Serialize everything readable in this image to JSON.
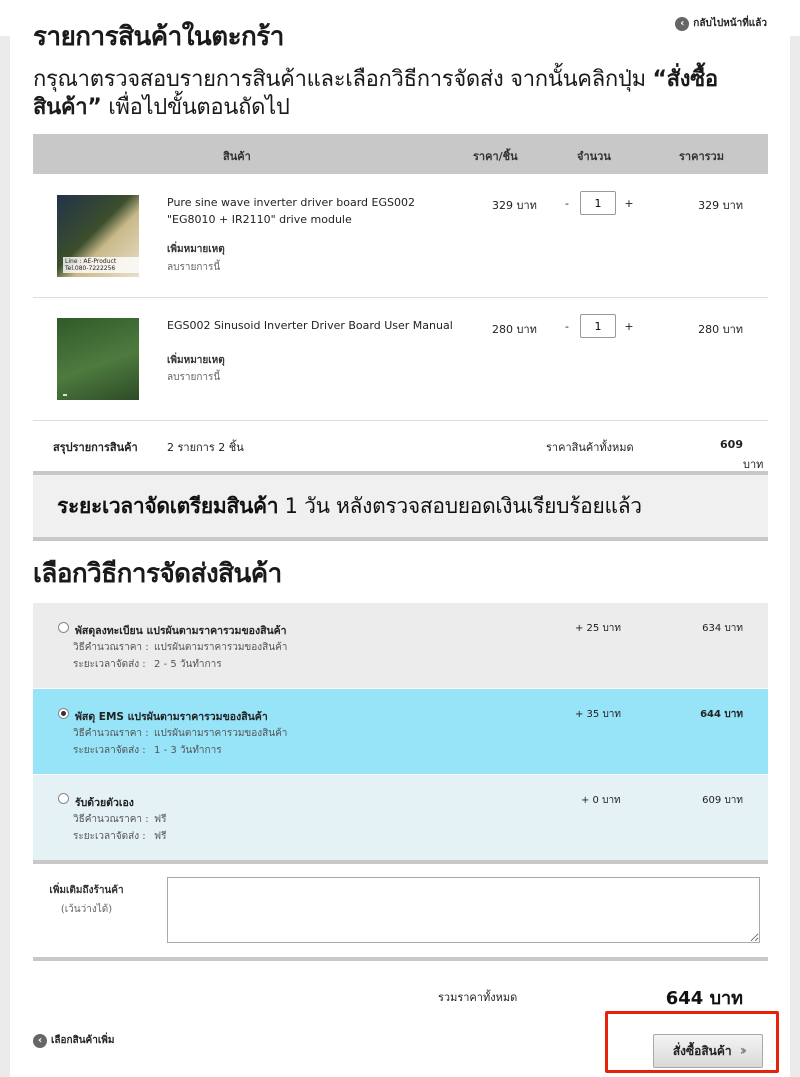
{
  "header": {
    "title": "รายการสินค้าในตะกร้า",
    "back_label": "กลับไปหน้าที่แล้ว",
    "instruction_pre": "กรุณาตรวจสอบรายการสินค้าและเลือกวิธีการจัดส่ง จากนั้นคลิกปุ่ม ",
    "instruction_bold": "“สั่งซื้อสินค้า”",
    "instruction_post": " เพื่อไปขั้นตอนถัดไป"
  },
  "table": {
    "columns": [
      "สินค้า",
      "ราคา/ชิ้น",
      "จำนวน",
      "ราคารวม"
    ],
    "items": [
      {
        "name_line1": "Pure sine wave inverter driver board EGS002",
        "name_line2": "\"EG8010 + IR2110\" drive module",
        "note_label": "เพิ่มหมายเหตุ",
        "remove_label": "ลบรายการนี้",
        "price": "329 บาท",
        "qty": "1",
        "total": "329 บาท",
        "thumb_text": "Line : AE-Product  Tel.080-7222256"
      },
      {
        "name_line1": "EGS002 Sinusoid Inverter Driver Board User Manual",
        "name_line2": "",
        "note_label": "เพิ่มหมายเหตุ",
        "remove_label": "ลบรายการนี้",
        "price": "280 บาท",
        "qty": "1",
        "total": "280 บาท",
        "thumb_text": ""
      }
    ],
    "minus": "-",
    "plus": "+"
  },
  "summary": {
    "label": "สรุปรายการสินค้า",
    "count": "2 รายการ 2 ชิ้น",
    "total_label": "ราคาสินค้าทั้งหมด",
    "total_num": "609",
    "total_unit": " บาท"
  },
  "prep": {
    "bold": "ระยะเวลาจัดเตรียมสินค้า",
    "rest": " 1 วัน หลังตรวจสอบยอดเงินเรียบร้อยแล้ว"
  },
  "shipping": {
    "title": "เลือกวิธีการจัดส่งสินค้า",
    "method_label": "วิธีคำนวณราคา :",
    "time_label": "ระยะเวลาจัดส่ง :",
    "options": [
      {
        "name": "พัสดุลงทะเบียน แปรผันตามราคารวมของสินค้า",
        "method": "แปรผันตามราคารวมของสินค้า",
        "time": "2 - 5 วันทำการ",
        "add": "+ 25 บาท",
        "total": "634 บาท",
        "selected": false
      },
      {
        "name": "พัสดุ EMS แปรผันตามราคารวมของสินค้า",
        "method": "แปรผันตามราคารวมของสินค้า",
        "time": "1 - 3 วันทำการ",
        "add": "+ 35 บาท",
        "total": "644 บาท",
        "selected": true
      },
      {
        "name": "รับด้วยตัวเอง",
        "method": "ฟรี",
        "time": "ฟรี",
        "add": "+ 0 บาท",
        "total": "609 บาท",
        "selected": false
      }
    ]
  },
  "remark": {
    "label": "เพิ่มเติมถึงร้านค้า",
    "hint": "(เว้นว่างได้)",
    "value": ""
  },
  "footer": {
    "grand_label": "รวมราคาทั้งหมด",
    "grand_value": "644 บาท",
    "more_label": "เลือกสินค้าเพิ่ม",
    "order_label": "สั่งซื้อสินค้า"
  },
  "colors": {
    "selected_bg": "#97e3f8",
    "option_bg": "#ececec",
    "pickup_bg": "#e4f2f6",
    "highlight": "#e8220a"
  }
}
